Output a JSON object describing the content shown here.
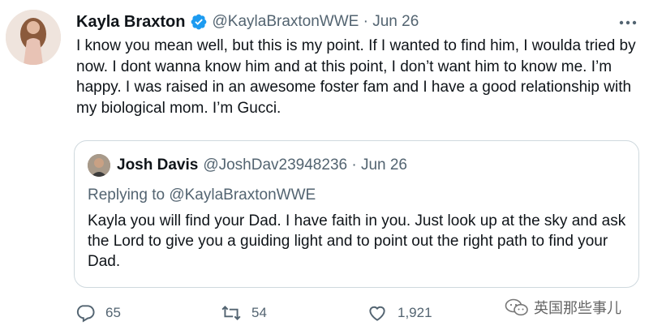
{
  "tweet": {
    "author_name": "Kayla Braxton",
    "handle_date": "@KaylaBraxtonWWE · Jun 26",
    "text": "I know you mean well, but this is my point. If I wanted to find him, I woulda tried by now. I dont wanna know him and at this point, I don’t want him to know me. I’m happy. I was raised in an awesome foster fam and I have a good relationship with my biological mom. I’m Gucci."
  },
  "quoted_tweet": {
    "author_name": "Josh Davis",
    "handle_date": "@JoshDav23948236 · Jun 26",
    "replying_prefix": "Replying to ",
    "replying_handle": "@KaylaBraxtonWWE",
    "text": "Kayla you will find your Dad. I have faith in you. Just look up at the sky and ask the Lord to give you a guiding light and to point out the right path to find your Dad."
  },
  "actions": {
    "replies": "65",
    "retweets": "54",
    "likes": "1,921"
  },
  "watermark": "英国那些事儿",
  "icons": [
    "verified-badge-icon",
    "more-icon",
    "reply-icon",
    "retweet-icon",
    "like-icon",
    "share-icon",
    "wechat-icon"
  ],
  "colors": {
    "verified": "#1d9bf0",
    "secondary_text": "#536471",
    "border": "#cfd9de"
  }
}
